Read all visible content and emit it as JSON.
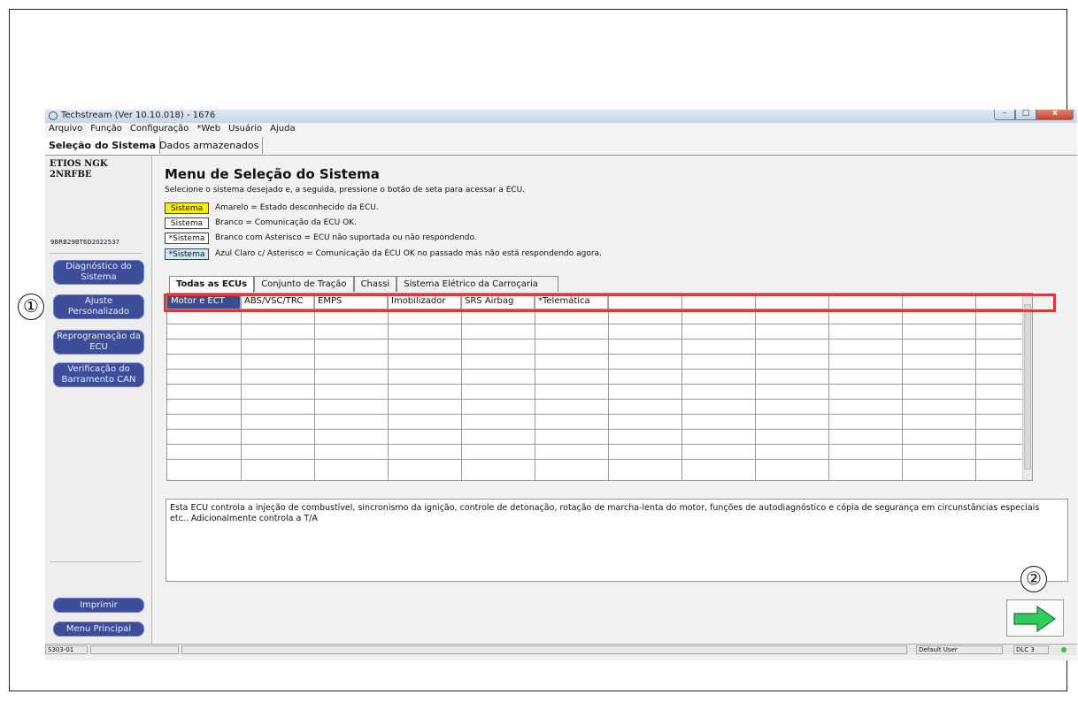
{
  "window": {
    "title": "Techstream (Ver 10.10.018) - 1676",
    "controls": {
      "minimize": "–",
      "maximize": "□",
      "close": "x"
    }
  },
  "menubar": [
    "Arquivo",
    "Função",
    "Configuração",
    "*Web",
    "Usuário",
    "Ajuda"
  ],
  "tabs": [
    "Seleção do Sistema",
    "Dados armazenados"
  ],
  "sidebar": {
    "vehicle_line1": "ETIOS NGK",
    "vehicle_line2": "2NRFBE",
    "vin": "9BRB29BT6D2022537",
    "buttons": [
      "Diagnóstico do Sistema",
      "Ajuste Personalizado",
      "Reprogramação da ECU",
      "Verificação do Barramento CAN"
    ],
    "bottom_buttons": [
      "Imprimir",
      "Menu Principal"
    ]
  },
  "main": {
    "heading": "Menu de Seleção do Sistema",
    "instruction": "Selecione o sistema desejado e, a seguida, pressione o botão de seta para acessar a ECU.",
    "legend": [
      {
        "swatch": "Sistema",
        "text": "Amarelo = Estado desconhecido da ECU.",
        "color": "#f6f000"
      },
      {
        "swatch": "Sistema",
        "text": "Branco = Comunicação da ECU OK.",
        "color": "#ffffff"
      },
      {
        "swatch": "*Sistema",
        "text": "Branco com Asterisco = ECU não suportada ou não respondendo.",
        "color": "#ffffff"
      },
      {
        "swatch": "*Sistema",
        "text": "Azul Claro c/ Asterisco = Comunicação da ECU OK no passado más não está respondendo agora.",
        "color": "#cfe8f7"
      }
    ],
    "ecu_tabs": [
      "Todas as ECUs",
      "Conjunto de Tração",
      "Chassi",
      "Sistema Elétrico da Carroçaria"
    ],
    "ecu_row": [
      "Motor e ECT",
      "ABS/VSC/TRC",
      "EMPS",
      "Imobilizador",
      "SRS Airbag",
      "*Telemática"
    ],
    "description": "Esta ECU controla a injeção de combustível, sincronismo da ignição, controle de detonação, rotação de marcha-lenta do motor, funções de autodiagnóstico e cópia de segurança em circunstâncias especiais etc.. Adicionalmente controla a T/A"
  },
  "statusbar": {
    "code": "S303-01",
    "user": "Default User",
    "connection": "DLC 3"
  },
  "callouts": [
    "①",
    "②"
  ],
  "colors": {
    "nav_button": "#3d4d99",
    "selected_cell": "#3a4c92",
    "highlight": "#e0383a",
    "arrow": "#27a84a"
  }
}
